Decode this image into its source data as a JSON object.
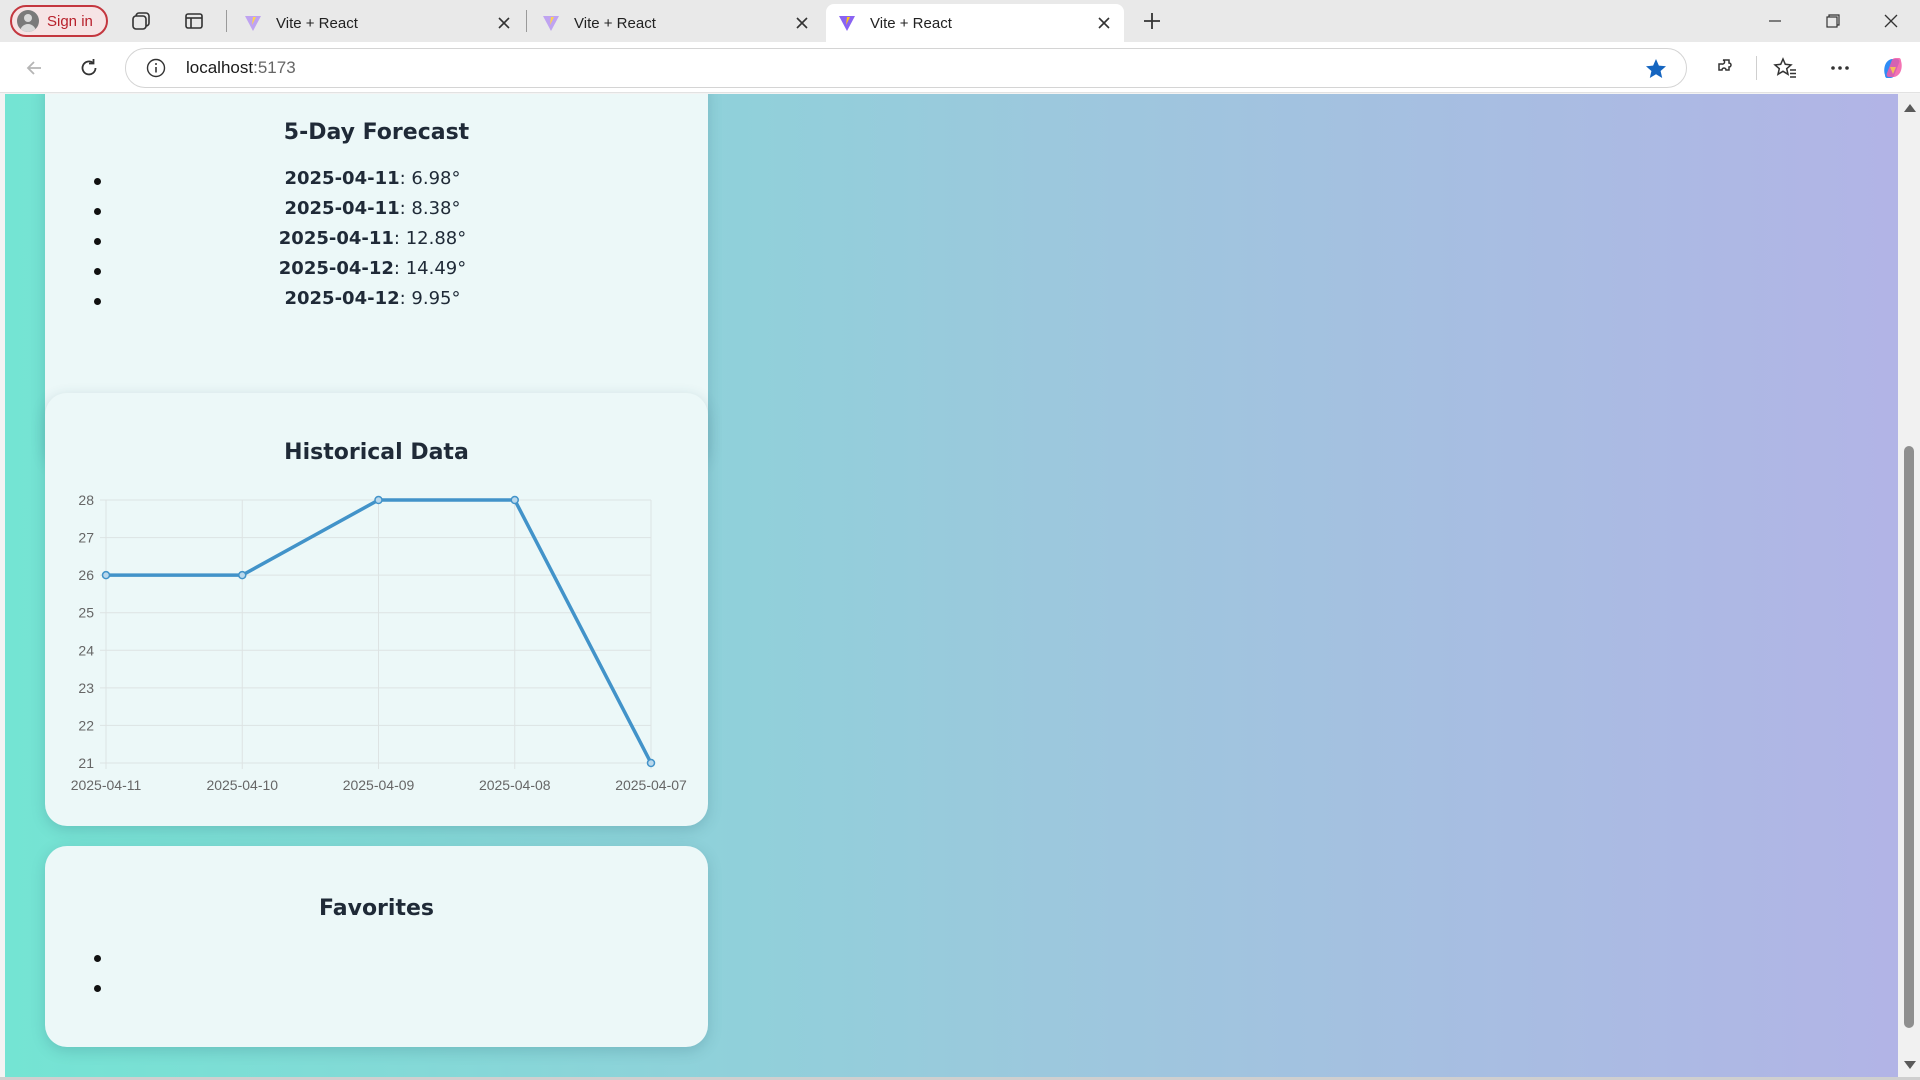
{
  "browser": {
    "sign_in_label": "Sign in",
    "tabs": [
      {
        "title": "Vite + React",
        "active": false
      },
      {
        "title": "Vite + React",
        "active": false
      },
      {
        "title": "Vite + React",
        "active": true
      }
    ],
    "url_host": "localhost",
    "url_port": ":5173",
    "colors": {
      "signin_border": "#c4373f",
      "star": "#1565c0"
    }
  },
  "page": {
    "background_gradient": [
      "#74e4d3",
      "#9cc8dd",
      "#b2b4e6"
    ],
    "forecast": {
      "title": "5-Day Forecast",
      "items": [
        {
          "date": "2025-04-11",
          "temp": ": 6.98°"
        },
        {
          "date": "2025-04-11",
          "temp": ": 8.38°"
        },
        {
          "date": "2025-04-11",
          "temp": ": 12.88°"
        },
        {
          "date": "2025-04-12",
          "temp": ": 14.49°"
        },
        {
          "date": "2025-04-12",
          "temp": ": 9.95°"
        }
      ]
    },
    "history": {
      "title": "Historical Data"
    },
    "favorites": {
      "title": "Favorites",
      "items": [
        "",
        ""
      ]
    }
  },
  "chart_data": {
    "type": "line",
    "x": [
      "2025-04-11",
      "2025-04-10",
      "2025-04-09",
      "2025-04-08",
      "2025-04-07"
    ],
    "series": [
      {
        "values": [
          26,
          26,
          28,
          28,
          21
        ],
        "color": "#4293c9"
      }
    ],
    "ylim": [
      21,
      28
    ],
    "yticks": [
      21,
      22,
      23,
      24,
      25,
      26,
      27,
      28
    ],
    "grid": true
  }
}
